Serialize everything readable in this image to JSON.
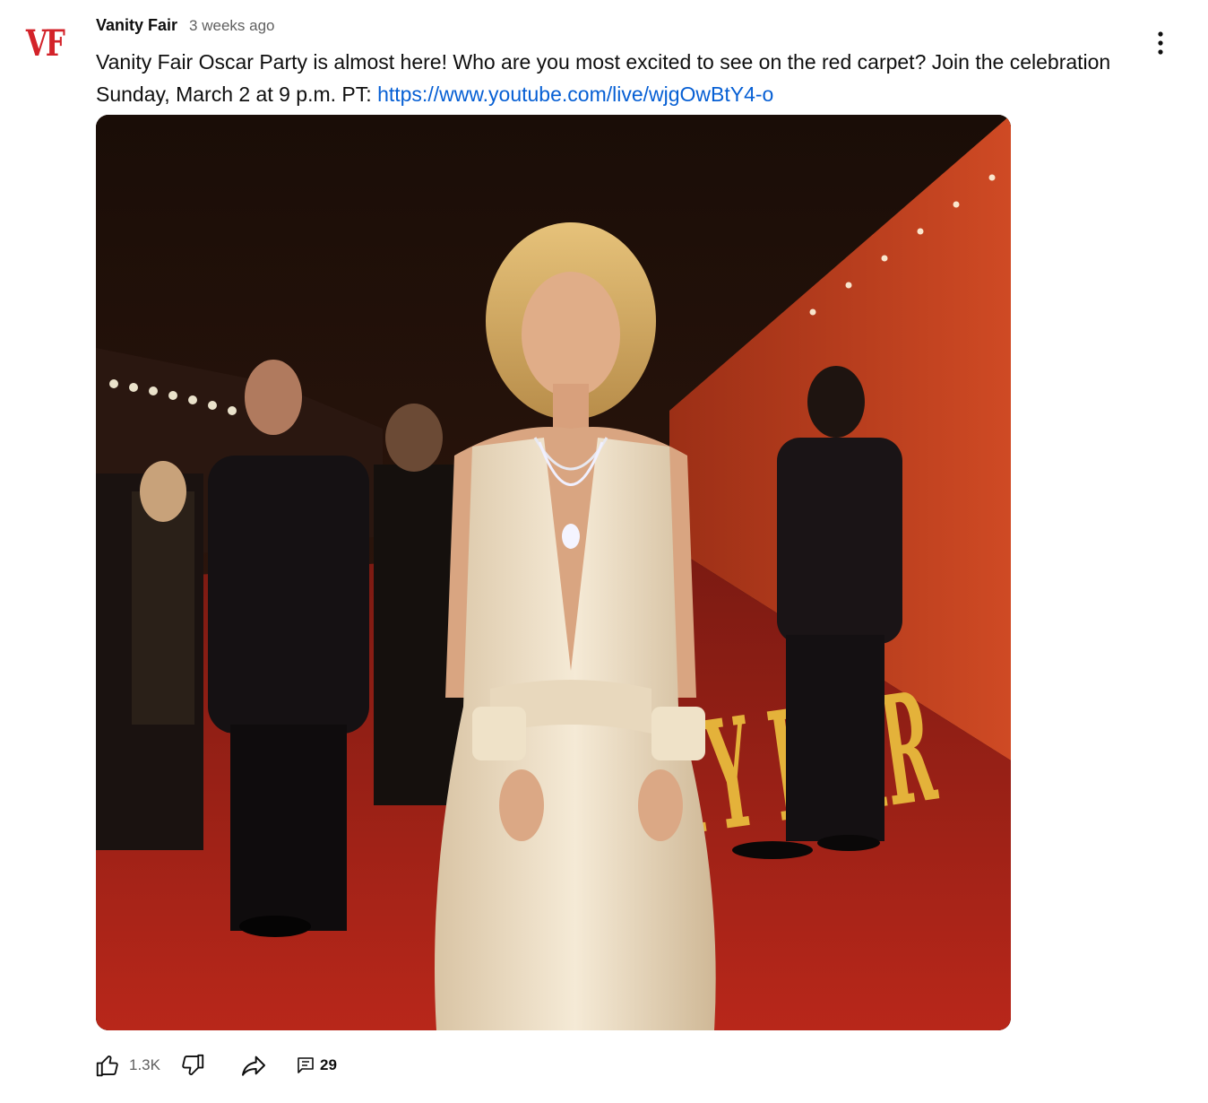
{
  "post": {
    "channel_logo_text": "VF",
    "channel_name": "Vanity Fair",
    "time_ago": "3 weeks ago",
    "text_before_link": "Vanity Fair Oscar Party is almost here! Who are you most excited to see on the red carpet? Join the celebration Sunday, March 2 at 9 p.m. PT: ",
    "link_text": "https://www.youtube.com/live/wjgOwBtY4-o",
    "image_backdrop_text": "VANITY FAIR",
    "likes": "1.3K",
    "comments": "29"
  },
  "colors": {
    "logo_red": "#d3232a",
    "link_blue": "#065fd4",
    "secondary_text": "#606060"
  },
  "icons": {
    "menu": "vertical-ellipsis-icon",
    "like": "thumbs-up-icon",
    "dislike": "thumbs-down-icon",
    "share": "share-arrow-icon",
    "comments": "comment-icon"
  }
}
